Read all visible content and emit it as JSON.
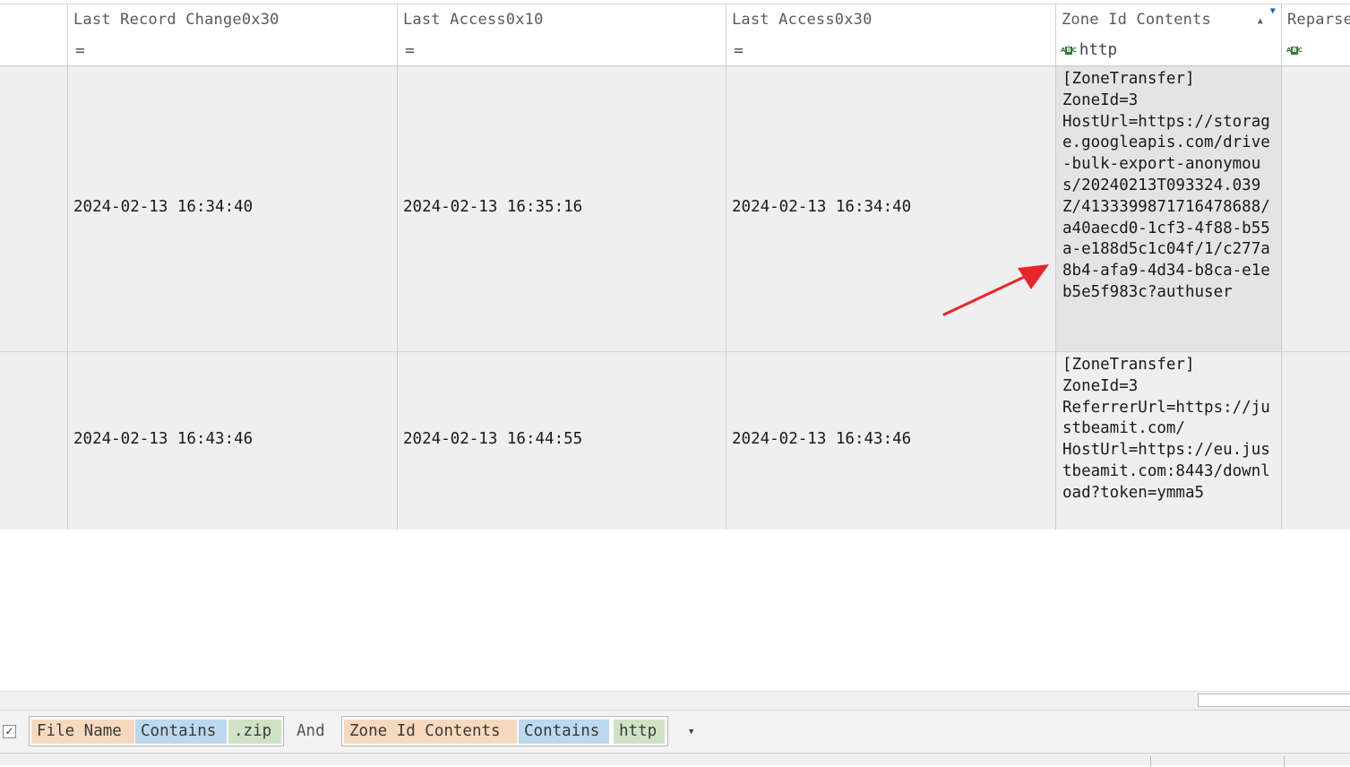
{
  "columns": [
    {
      "label": ""
    },
    {
      "label": "Last Record Change0x30"
    },
    {
      "label": "Last Access0x10"
    },
    {
      "label": "Last Access0x30"
    },
    {
      "label": "Zone Id Contents"
    },
    {
      "label": "Reparse"
    }
  ],
  "filters": {
    "c1": "=",
    "c2": "=",
    "c3": "=",
    "zone": "http"
  },
  "rows": [
    {
      "last_record_change_0x30": "2024-02-13 16:34:40",
      "last_access_0x10": "2024-02-13 16:35:16",
      "last_access_0x30": "2024-02-13 16:34:40",
      "zone_id_contents": "[ZoneTransfer]\nZoneId=3\nHostUrl=https://storage.googleapis.com/drive-bulk-export-anonymous/20240213T093324.039Z/4133399871716478688/a40aecd0-1cf3-4f88-b55a-e188d5c1c04f/1/c277a8b4-afa9-4d34-b8ca-e1eb5e5f983c?authuser"
    },
    {
      "last_record_change_0x30": "2024-02-13 16:43:46",
      "last_access_0x10": "2024-02-13 16:44:55",
      "last_access_0x30": "2024-02-13 16:43:46",
      "zone_id_contents": "[ZoneTransfer]\nZoneId=3\nReferrerUrl=https://justbeamit.com/\nHostUrl=https://eu.justbeamit.com:8443/download?token=ymma5"
    }
  ],
  "filter_bar": {
    "checked_glyph": "✓",
    "group1": {
      "field": "File Name",
      "op": "Contains",
      "value": ".zip"
    },
    "join": "And",
    "group2": {
      "field": "Zone Id Contents",
      "op": "Contains",
      "value": "http"
    }
  },
  "colors": {
    "row_bg": "#efefef",
    "annotation_arrow": "#e8262a",
    "token_field": "#f6d9bf",
    "token_op": "#bcd9ef",
    "token_value": "#cfe3c4"
  }
}
